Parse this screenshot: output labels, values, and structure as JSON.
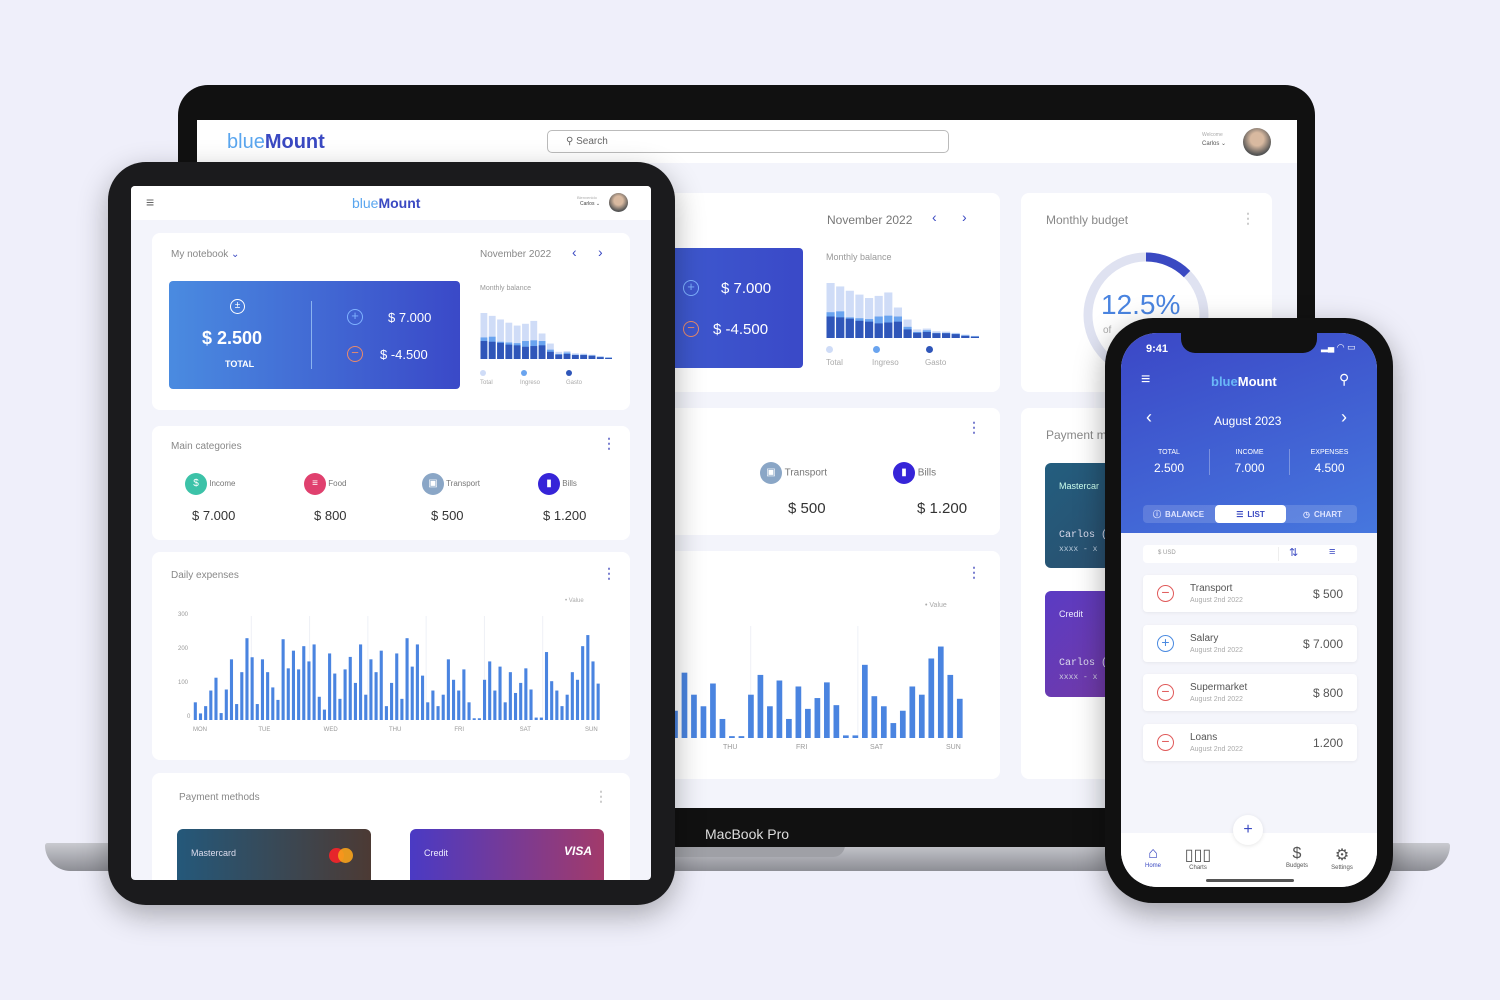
{
  "brand": {
    "part1": "blue",
    "part2": "Mount"
  },
  "colors": {
    "accent": "#3a49c2",
    "light_blue": "#5aa6ef",
    "bar": "#4a84e0",
    "income_icon": "#3cc2a8",
    "food_icon": "#e0406e",
    "transport_icon": "#8aa6c6",
    "bills_icon": "#3624d8",
    "minus": "#e05a5a",
    "plus": "#4a8ae0"
  },
  "laptop": {
    "search_placeholder": "Search",
    "welcome": "Welcome",
    "user": "Carlos",
    "month": "November 2022",
    "monthly_balance": "Monthly balance",
    "income": "$ 7.000",
    "expense": "$ -4.500",
    "legend": [
      "Total",
      "Ingreso",
      "Gasto"
    ],
    "categories": [
      {
        "label": "Transport",
        "value": "$ 500"
      },
      {
        "label": "Bills",
        "value": "$ 1.200"
      }
    ],
    "value_legend": "Value",
    "days": [
      "THU",
      "FRI",
      "SAT",
      "SUN"
    ],
    "budget_title": "Monthly budget",
    "budget_percent": "12.5%",
    "budget_fraction": 0.125,
    "budget_sub": "of",
    "payment_title": "Payment m",
    "cards": [
      {
        "label": "Mastercar",
        "holder": "Carlos (",
        "number": "xxxx - x"
      },
      {
        "label": "Credit",
        "holder": "Carlos (",
        "number": "xxxx - x"
      }
    ],
    "device_label": "MacBook Pro"
  },
  "tablet": {
    "welcome": "Bienvenido",
    "user": "Carlos",
    "notebook": "My notebook",
    "month": "November 2022",
    "total": "$ 2.500",
    "total_label": "TOTAL",
    "income": "$ 7.000",
    "expense": "$ -4.500",
    "monthly_balance": "Monthly balance",
    "legend": [
      "Total",
      "Ingreso",
      "Gasto"
    ],
    "main_categories": "Main categories",
    "categories": [
      {
        "label": "Income",
        "value": "$ 7.000",
        "icon": "dollar-icon"
      },
      {
        "label": "Food",
        "value": "$ 800",
        "icon": "burger-icon"
      },
      {
        "label": "Transport",
        "value": "$ 500",
        "icon": "bus-icon"
      },
      {
        "label": "Bills",
        "value": "$ 1.200",
        "icon": "bar-chart-icon"
      }
    ],
    "daily_title": "Daily expenses",
    "value_legend": "Value",
    "yticks": [
      "300",
      "200",
      "100",
      "0"
    ],
    "days": [
      "MON",
      "TUE",
      "WED",
      "THU",
      "FRI",
      "SAT",
      "SUN"
    ],
    "payment_title": "Payment methods",
    "cards": [
      {
        "label": "Mastercard",
        "brand": "mastercard"
      },
      {
        "label": "Credit",
        "brand": "VISA"
      }
    ]
  },
  "phone": {
    "time": "9:41",
    "month": "August 2023",
    "stats": [
      {
        "label": "TOTAL",
        "value": "2.500"
      },
      {
        "label": "INCOME",
        "value": "7.000"
      },
      {
        "label": "EXPENSES",
        "value": "4.500"
      }
    ],
    "tabs": [
      {
        "label": "BALANCE",
        "active": false
      },
      {
        "label": "LIST",
        "active": true
      },
      {
        "label": "CHART",
        "active": false
      }
    ],
    "currency": "$ USD",
    "items": [
      {
        "title": "Transport",
        "date": "August 2nd 2022",
        "amount": "$ 500",
        "type": "expense"
      },
      {
        "title": "Salary",
        "date": "August 2nd 2022",
        "amount": "$ 7.000",
        "type": "income"
      },
      {
        "title": "Supermarket",
        "date": "August 2nd 2022",
        "amount": "$ 800",
        "type": "expense"
      },
      {
        "title": "Loans",
        "date": "August 2nd 2022",
        "amount": "1.200",
        "type": "expense"
      }
    ],
    "nav": [
      {
        "label": "Home",
        "active": true
      },
      {
        "label": "Charts"
      },
      {
        "label": "Budgets"
      },
      {
        "label": "Settings"
      }
    ]
  },
  "chart_data": [
    {
      "type": "bar",
      "title": "Daily expenses",
      "categories": [
        "MON",
        "TUE",
        "WED",
        "THU",
        "FRI",
        "SAT",
        "SUN"
      ],
      "ylim": [
        0,
        300
      ],
      "yticks": [
        0,
        100,
        200,
        300
      ],
      "grid": true,
      "legend": "top-right",
      "series": [
        {
          "name": "Value",
          "values": [
            51,
            19,
            40,
            85,
            122,
            20,
            88,
            175,
            46,
            138,
            236,
            181,
            46,
            175,
            138,
            94,
            58,
            233,
            149,
            200,
            146,
            213,
            169,
            218,
            67,
            30,
            192,
            134,
            61,
            146,
            182,
            107,
            218,
            73,
            175,
            138,
            200,
            40,
            107,
            192,
            61,
            236,
            154,
            218,
            128,
            51,
            85,
            40,
            73,
            175,
            116,
            85,
            146,
            51,
            5,
            5,
            116,
            169,
            85,
            154,
            51,
            138,
            78,
            107,
            149,
            88,
            7,
            7,
            196,
            112,
            85,
            40,
            73,
            138,
            116,
            213,
            245,
            169,
            105
          ]
        }
      ]
    },
    {
      "type": "bar",
      "title": "Monthly balance",
      "stacked": false,
      "legend": "bottom",
      "series": [
        {
          "name": "Total",
          "values": [
            128,
            120,
            110,
            101,
            93,
            98,
            106,
            71,
            43,
            20,
            22,
            16,
            15,
            12,
            8,
            5
          ]
        },
        {
          "name": "Ingreso",
          "values": [
            60,
            62,
            48,
            46,
            44,
            50,
            52,
            50,
            26,
            14,
            18,
            12,
            12,
            10,
            6,
            4
          ]
        },
        {
          "name": "Gasto",
          "values": [
            50,
            48,
            45,
            40,
            38,
            34,
            36,
            38,
            20,
            12,
            14,
            11,
            11,
            9,
            5,
            3
          ]
        }
      ]
    }
  ]
}
